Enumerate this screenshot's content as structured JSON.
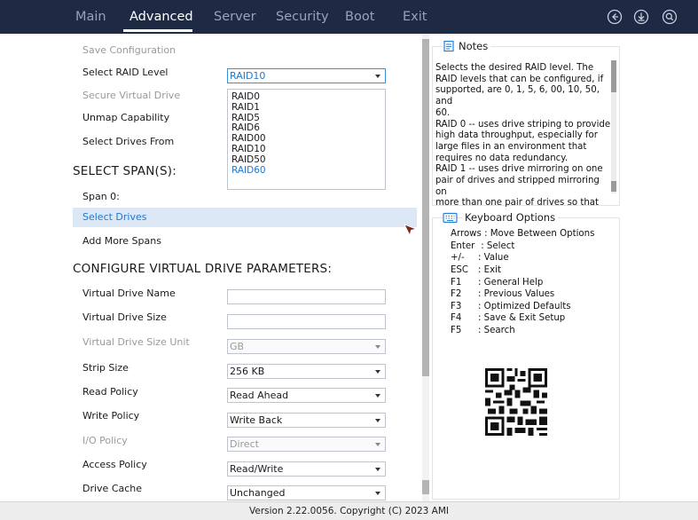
{
  "nav": {
    "tabs": [
      {
        "label": "Main"
      },
      {
        "label": "Advanced"
      },
      {
        "label": "Server"
      },
      {
        "label": "Security"
      },
      {
        "label": "Boot"
      },
      {
        "label": "Exit"
      }
    ],
    "active_tab": "Advanced",
    "icons": [
      "back-circle-icon",
      "download-circle-icon",
      "search-circle-icon"
    ]
  },
  "form": {
    "save_configuration": "Save Configuration",
    "select_raid_level": {
      "label": "Select RAID Level",
      "value": "RAID10"
    },
    "secure_virtual_drive": "Secure Virtual Drive",
    "unmap_capability": "Unmap Capability",
    "select_drives_from": "Select Drives From",
    "raid_options": [
      "RAID0",
      "RAID1",
      "RAID5",
      "RAID6",
      "RAID00",
      "RAID10",
      "RAID50",
      "RAID60"
    ],
    "raid_option_focused": "RAID60",
    "select_spans_title": "SELECT SPAN(S):",
    "span0": "Span 0:",
    "select_drives": "Select Drives",
    "add_more_spans": "Add More Spans",
    "configure_title": "CONFIGURE VIRTUAL DRIVE PARAMETERS:",
    "vd_name": {
      "label": "Virtual Drive Name",
      "value": ""
    },
    "vd_size": {
      "label": "Virtual Drive Size",
      "value": ""
    },
    "vd_size_unit": {
      "label": "Virtual Drive Size Unit",
      "value": "GB"
    },
    "strip_size": {
      "label": "Strip Size",
      "value": "256 KB"
    },
    "read_policy": {
      "label": "Read Policy",
      "value": "Read Ahead"
    },
    "write_policy": {
      "label": "Write Policy",
      "value": "Write Back"
    },
    "io_policy": {
      "label": "I/O Policy",
      "value": "Direct"
    },
    "access_policy": {
      "label": "Access Policy",
      "value": "Read/Write"
    },
    "drive_cache": {
      "label": "Drive Cache",
      "value": "Unchanged"
    }
  },
  "notes": {
    "title": "Notes",
    "lines": [
      "Selects the desired RAID level. The",
      "RAID levels that can be configured, if",
      "supported, are 0, 1, 5, 6, 00, 10, 50, and",
      "60.",
      "RAID 0 -- uses drive striping to provide",
      "high data throughput, especially for",
      "large files in an environment that",
      "requires no data redundancy.",
      "RAID 1 -- uses drive mirroring on one",
      "pair of drives and stripped mirroring on",
      "more than one pair of drives so that"
    ]
  },
  "keyboard": {
    "title": "Keyboard Options",
    "items": [
      {
        "key": "Arrows",
        "desc": ": Move Between Options"
      },
      {
        "key": "Enter",
        "desc": ": Select"
      },
      {
        "key": "+/-",
        "desc": ": Value"
      },
      {
        "key": "ESC",
        "desc": ": Exit"
      },
      {
        "key": "F1",
        "desc": ": General Help"
      },
      {
        "key": "F2",
        "desc": ": Previous Values"
      },
      {
        "key": "F3",
        "desc": ": Optimized Defaults"
      },
      {
        "key": "F4",
        "desc": ": Save & Exit Setup"
      },
      {
        "key": "F5",
        "desc": ": Search"
      }
    ]
  },
  "footer": {
    "text": "Version 2.22.0056. Copyright (C) 2023 AMI"
  },
  "colors": {
    "nav_bg": "#1e2a44",
    "accent": "#1e78d0",
    "highlight": "#dde8f6"
  }
}
